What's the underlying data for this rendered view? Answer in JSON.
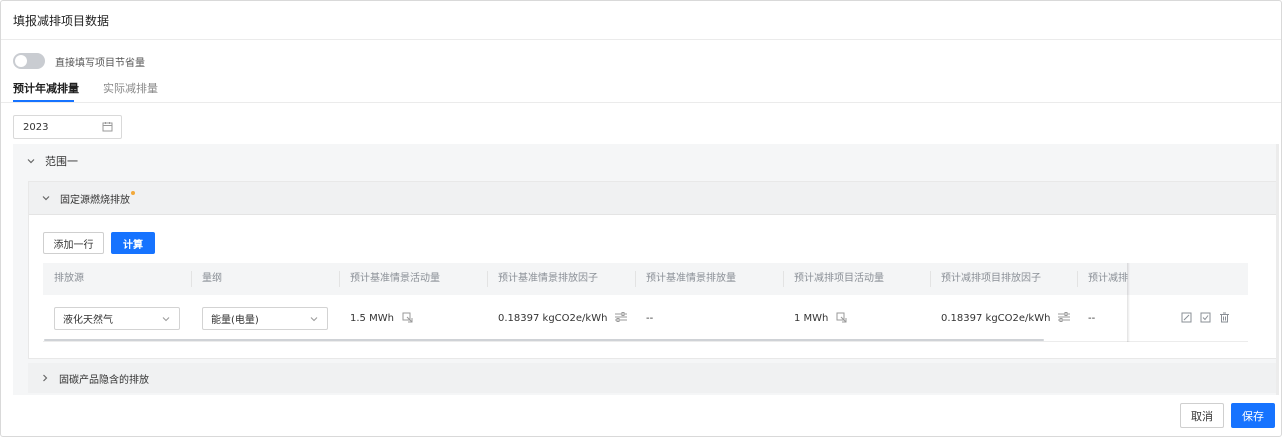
{
  "window": {
    "title": "填报减排项目数据"
  },
  "toggle": {
    "label": "直接填写项目节省量",
    "on": false
  },
  "tabs": [
    {
      "label": "预计年减排量",
      "active": true
    },
    {
      "label": "实际减排量",
      "active": false
    }
  ],
  "year_picker": {
    "value": "2023",
    "icon": "calendar-icon"
  },
  "scope": {
    "title": "范围一",
    "expanded": true,
    "sections": [
      {
        "title": "固定源燃烧排放",
        "expanded": true,
        "has_indicator": true,
        "indicator_color": "#f2a93b",
        "buttons": {
          "add_row": "添加一行",
          "calculate": "计算"
        },
        "columns": [
          "排放源",
          "量纲",
          "预计基准情景活动量",
          "预计基准情景排放因子",
          "预计基准情景排放量",
          "预计减排项目活动量",
          "预计减排项目排放因子",
          "预计减排"
        ],
        "rows": [
          {
            "source": "液化天然气",
            "dimension": "能量(电量)",
            "baseline_activity": "1.5 MWh",
            "baseline_factor": "0.18397 kgCO2e/kWh",
            "baseline_emission": "--",
            "project_activity": "1 MWh",
            "project_factor": "0.18397 kgCO2e/kWh",
            "project_emission": "--"
          }
        ]
      },
      {
        "title": "固碳产品隐含的排放",
        "expanded": false
      }
    ]
  },
  "footer": {
    "cancel": "取消",
    "save": "保存"
  },
  "colors": {
    "accent": "#1673ff",
    "indicator": "#f2a93b"
  }
}
